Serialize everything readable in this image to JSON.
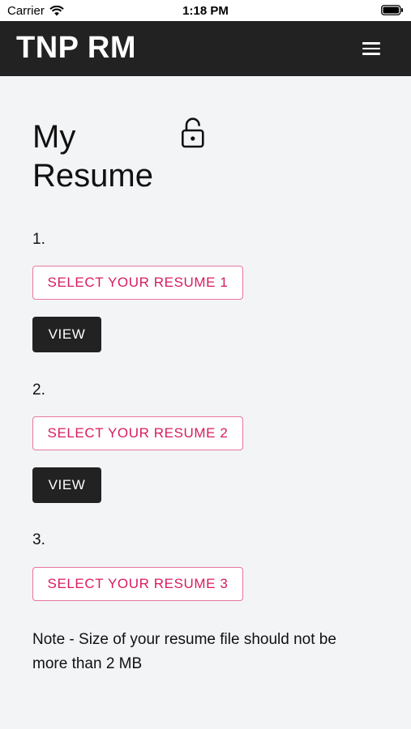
{
  "status_bar": {
    "carrier": "Carrier",
    "time": "1:18 PM"
  },
  "app_bar": {
    "title": "TNP RM"
  },
  "page": {
    "title": "My Resume"
  },
  "resumes": [
    {
      "number": "1.",
      "select_label": "SELECT YOUR RESUME 1",
      "view_label": "VIEW"
    },
    {
      "number": "2.",
      "select_label": "SELECT YOUR RESUME 2",
      "view_label": "VIEW"
    },
    {
      "number": "3.",
      "select_label": "SELECT YOUR RESUME 3"
    }
  ],
  "note": "Note - Size of your resume file should not be more than 2 MB",
  "colors": {
    "app_bar": "#222222",
    "accent": "#d81b60",
    "background": "#f3f4f6"
  }
}
